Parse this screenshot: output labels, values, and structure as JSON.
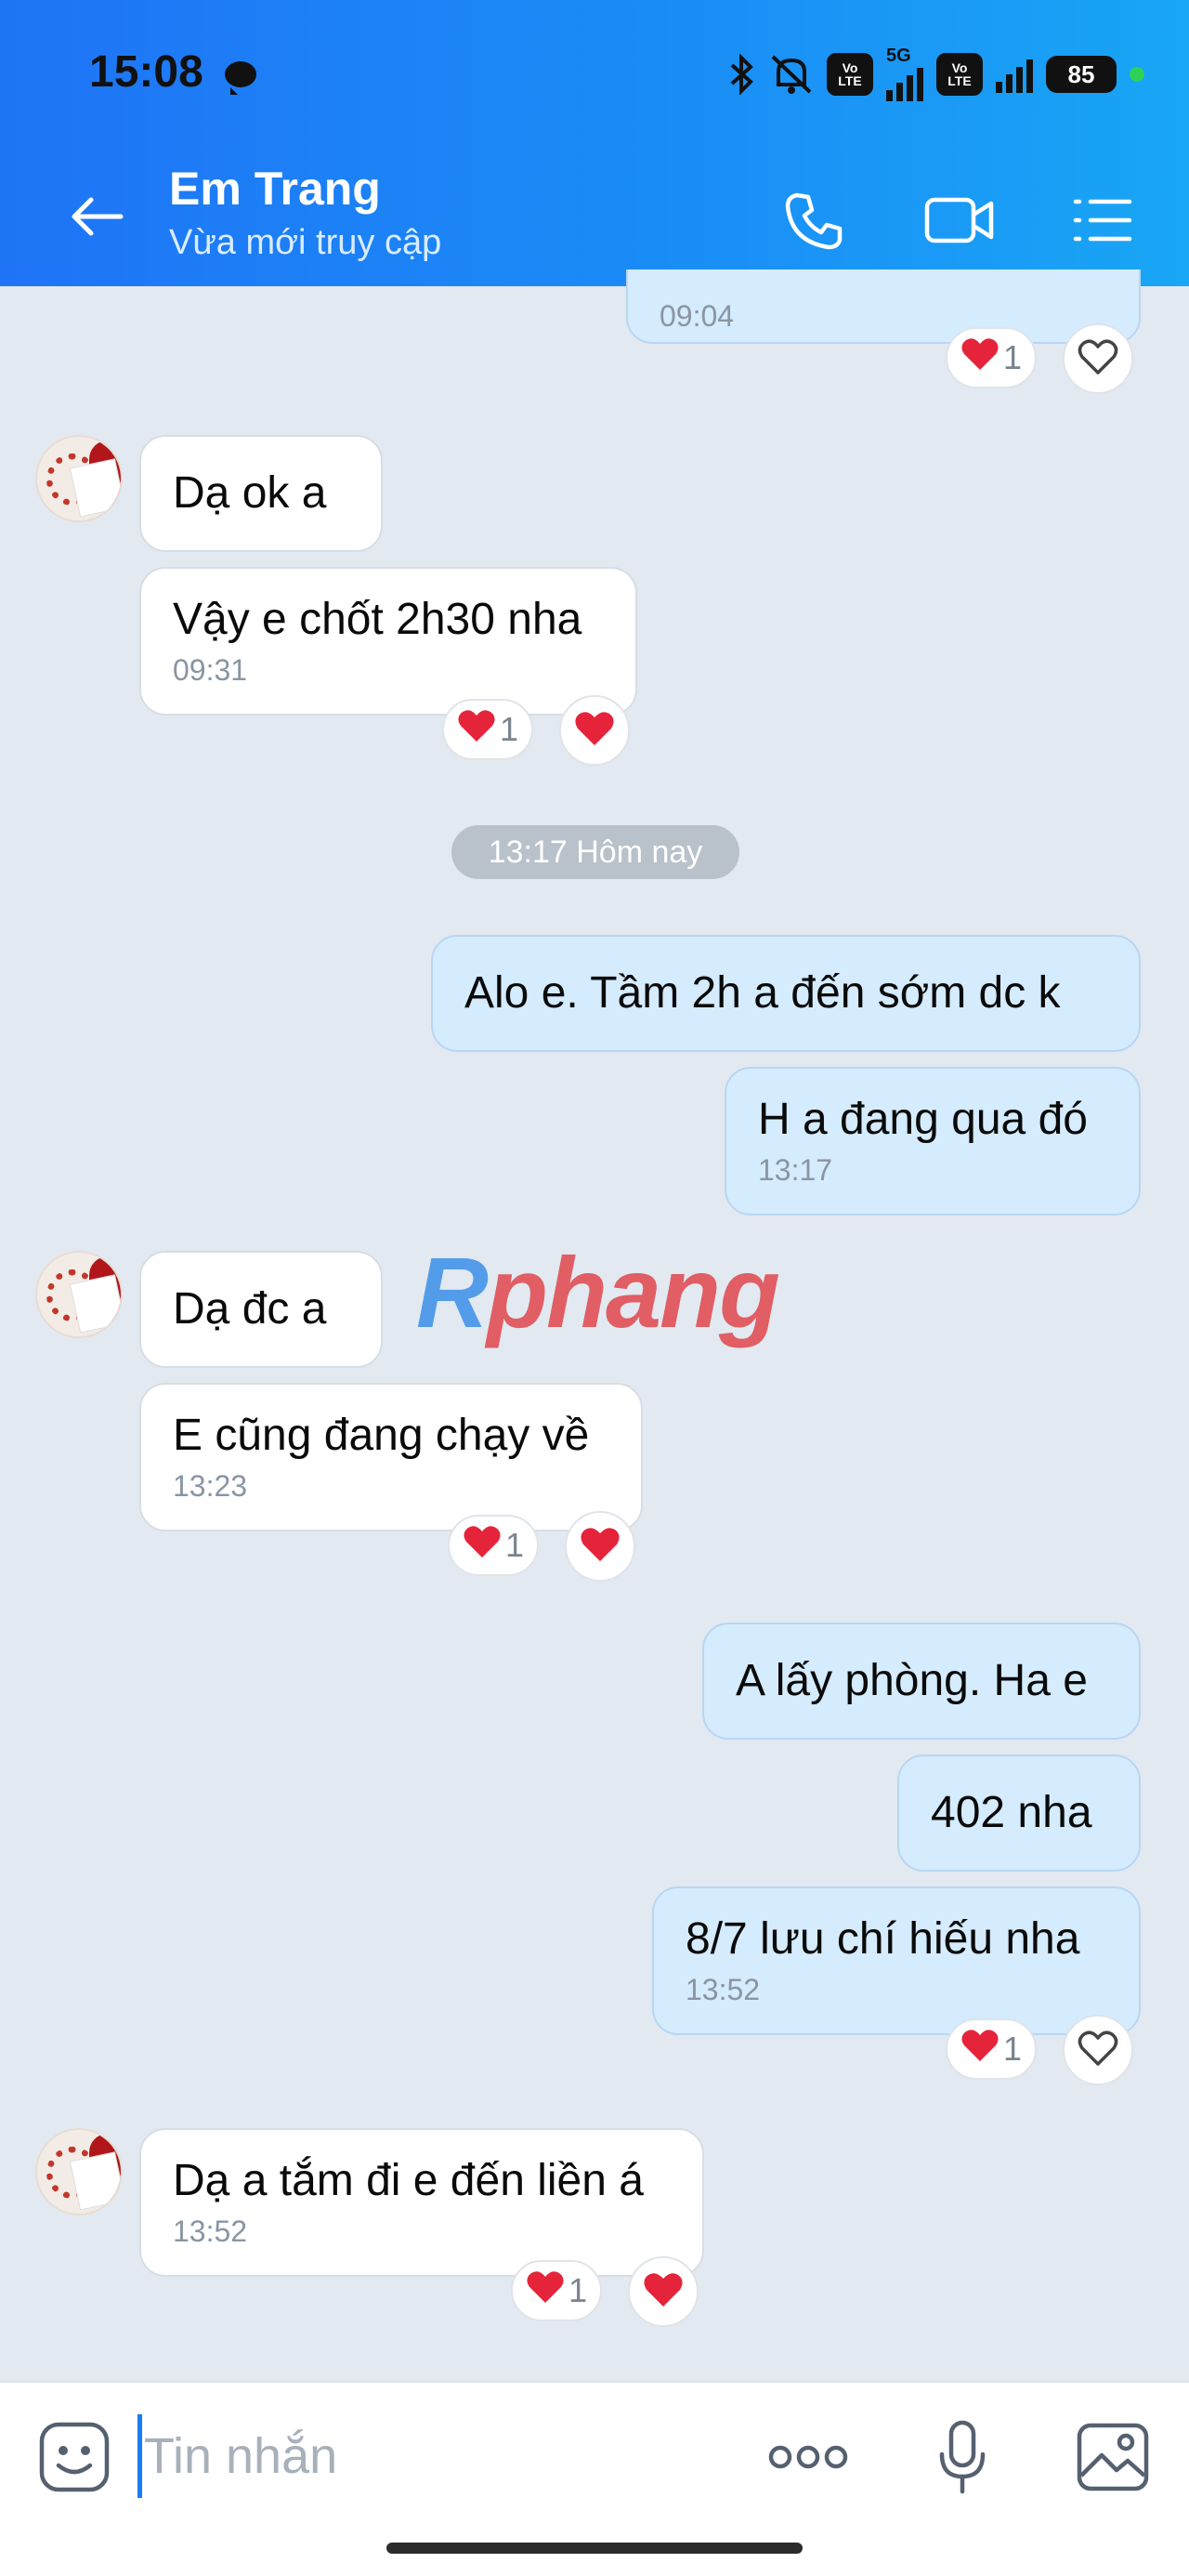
{
  "status_bar": {
    "time": "15:08",
    "network": "5G",
    "volte_1": "Vo LTE",
    "volte_2": "Vo LTE",
    "battery": "85"
  },
  "header": {
    "contact_name": "Em Trang",
    "contact_status": "Vừa mới truy cập"
  },
  "date_separator": "13:17 Hôm nay",
  "watermark": {
    "part1": "R",
    "part2": "phang"
  },
  "messages": [
    {
      "dir": "out",
      "text": "",
      "time": "09:04",
      "reaction_count": "1"
    },
    {
      "dir": "in",
      "text": "Dạ ok a"
    },
    {
      "dir": "in",
      "text": "Vậy e chốt 2h30 nha",
      "time": "09:31",
      "reaction_count": "1"
    },
    {
      "dir": "out",
      "text": "Alo e.  Tầm 2h a đến sớm dc k"
    },
    {
      "dir": "out",
      "text": "H a đang qua đó",
      "time": "13:17"
    },
    {
      "dir": "in",
      "text": "Dạ đc a"
    },
    {
      "dir": "in",
      "text": "E cũng đang chạy về",
      "time": "13:23",
      "reaction_count": "1"
    },
    {
      "dir": "out",
      "text": "A lấy phòng. Ha e"
    },
    {
      "dir": "out",
      "text": "402 nha"
    },
    {
      "dir": "out",
      "text": "8/7 lưu chí hiếu nha",
      "time": "13:52",
      "reaction_count": "1"
    },
    {
      "dir": "in",
      "text": "Dạ a tắm đi e đến liền á",
      "time": "13:52",
      "reaction_count": "1"
    }
  ],
  "composer": {
    "placeholder": "Tin nhắn"
  },
  "icons": {
    "back": "arrow-left-icon",
    "call": "phone-icon",
    "video": "video-camera-icon",
    "menu": "list-menu-icon",
    "emoji": "emoji-icon",
    "more": "more-dots-icon",
    "mic": "microphone-icon",
    "image": "image-icon",
    "heart": "heart-icon"
  },
  "colors": {
    "header_start": "#1f74f6",
    "header_end": "#19a6f5",
    "out_bubble": "#d5ebfe",
    "in_bubble": "#ffffff",
    "heart": "#e5243b"
  }
}
